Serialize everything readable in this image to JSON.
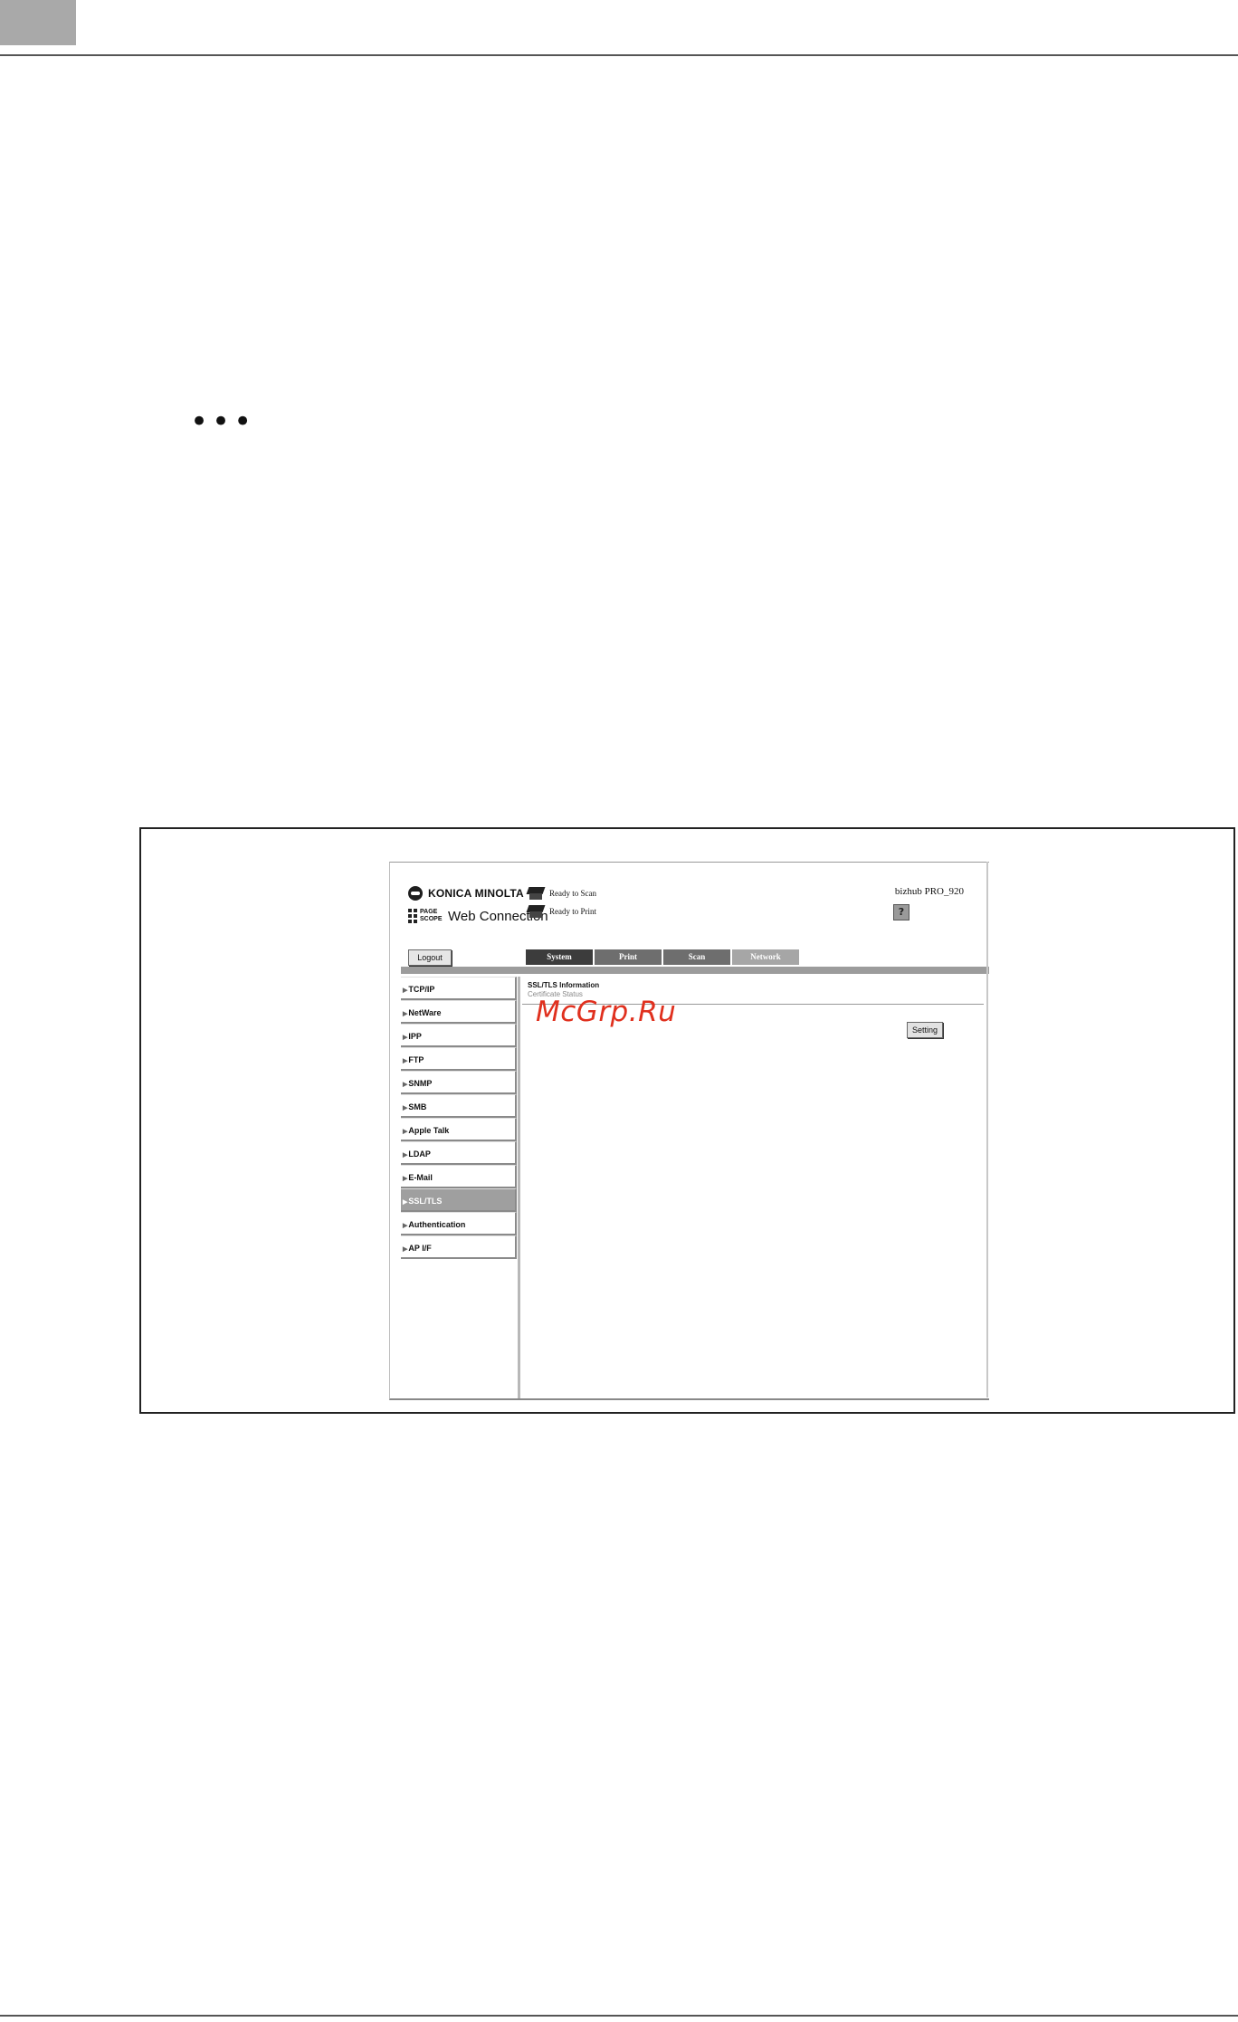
{
  "document": {
    "ellipsis": "•••"
  },
  "ui": {
    "brand": {
      "company": "KONICA MINOLTA",
      "pagescope": "PAGE SCOPE",
      "product": "Web Connection"
    },
    "status": {
      "scan": "Ready to Scan",
      "print": "Ready to Print"
    },
    "device_name": "bizhub PRO_920",
    "help_icon_glyph": "?",
    "logout_label": "Logout",
    "tabs": [
      {
        "label": "System",
        "state": "active"
      },
      {
        "label": "Print",
        "state": "normal"
      },
      {
        "label": "Scan",
        "state": "normal"
      },
      {
        "label": "Network",
        "state": "light"
      }
    ],
    "menu_arrow": "▶",
    "menu": [
      {
        "label": "TCP/IP"
      },
      {
        "label": "NetWare"
      },
      {
        "label": "IPP"
      },
      {
        "label": "FTP"
      },
      {
        "label": "SNMP"
      },
      {
        "label": "SMB"
      },
      {
        "label": "Apple Talk"
      },
      {
        "label": "LDAP"
      },
      {
        "label": "E-Mail"
      },
      {
        "label": "SSL/TLS",
        "selected": true
      },
      {
        "label": "Authentication"
      },
      {
        "label": "AP I/F"
      }
    ],
    "content": {
      "title": "SSL/TLS Information",
      "subtitle": "Certificate Status",
      "setting_label": "Setting"
    }
  },
  "watermark": "McGrp.Ru"
}
